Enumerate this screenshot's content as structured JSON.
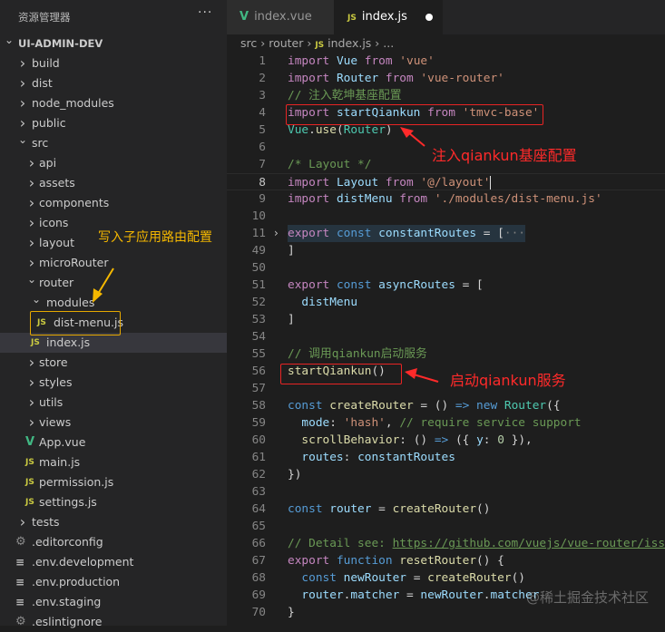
{
  "sidebar": {
    "title": "资源管理器",
    "more": "···",
    "items": [
      {
        "label": "UI-ADMIN-DEV",
        "type": "root",
        "icon": "chevron-down"
      },
      {
        "label": "build",
        "type": "folder",
        "level": 1
      },
      {
        "label": "dist",
        "type": "folder",
        "level": 1
      },
      {
        "label": "node_modules",
        "type": "folder",
        "level": 1
      },
      {
        "label": "public",
        "type": "folder",
        "level": 1
      },
      {
        "label": "src",
        "type": "folder-open",
        "level": 1
      },
      {
        "label": "api",
        "type": "folder",
        "level": 2
      },
      {
        "label": "assets",
        "type": "folder",
        "level": 2
      },
      {
        "label": "components",
        "type": "folder",
        "level": 2
      },
      {
        "label": "icons",
        "type": "folder",
        "level": 2
      },
      {
        "label": "layout",
        "type": "folder",
        "level": 2
      },
      {
        "label": "microRouter",
        "type": "folder",
        "level": 2
      },
      {
        "label": "router",
        "type": "folder-open",
        "level": 2
      },
      {
        "label": "modules",
        "type": "folder-open",
        "level": 3
      },
      {
        "label": "dist-menu.js",
        "type": "js",
        "level": 4
      },
      {
        "label": "index.js",
        "type": "js",
        "level": 3,
        "selected": true
      },
      {
        "label": "store",
        "type": "folder",
        "level": 2
      },
      {
        "label": "styles",
        "type": "folder",
        "level": 2
      },
      {
        "label": "utils",
        "type": "folder",
        "level": 2
      },
      {
        "label": "views",
        "type": "folder",
        "level": 2
      },
      {
        "label": "App.vue",
        "type": "vue",
        "level": 2
      },
      {
        "label": "main.js",
        "type": "js",
        "level": 2
      },
      {
        "label": "permission.js",
        "type": "js",
        "level": 2
      },
      {
        "label": "settings.js",
        "type": "js",
        "level": 2
      },
      {
        "label": "tests",
        "type": "folder",
        "level": 1
      },
      {
        "label": ".editorconfig",
        "type": "gear",
        "level": 1
      },
      {
        "label": ".env.development",
        "type": "lines",
        "level": 1
      },
      {
        "label": ".env.production",
        "type": "lines",
        "level": 1
      },
      {
        "label": ".env.staging",
        "type": "lines",
        "level": 1
      },
      {
        "label": ".eslintignore",
        "type": "gear",
        "level": 1
      }
    ]
  },
  "tabs": [
    {
      "label": "index.vue",
      "icon": "V"
    },
    {
      "label": "index.js",
      "icon": "JS",
      "modified": true
    }
  ],
  "breadcrumb": {
    "parts": [
      "src",
      "router"
    ],
    "file": "index.js",
    "icon": "JS",
    "tail": "..."
  },
  "code": [
    {
      "n": "1",
      "t": [
        [
          "import ",
          "kw"
        ],
        [
          "Vue ",
          "id"
        ],
        [
          "from ",
          "kw"
        ],
        [
          "'vue'",
          "str"
        ]
      ]
    },
    {
      "n": "2",
      "t": [
        [
          "import ",
          "kw"
        ],
        [
          "Router ",
          "id"
        ],
        [
          "from ",
          "kw"
        ],
        [
          "'vue-router'",
          "str"
        ]
      ]
    },
    {
      "n": "3",
      "t": [
        [
          "// 注入乾坤基座配置",
          "cm"
        ]
      ]
    },
    {
      "n": "4",
      "t": [
        [
          "import ",
          "kw"
        ],
        [
          "startQiankun ",
          "id"
        ],
        [
          "from ",
          "kw"
        ],
        [
          "'tmvc-base'",
          "str"
        ]
      ]
    },
    {
      "n": "5",
      "t": [
        [
          "Vue",
          "cls"
        ],
        [
          ".",
          ""
        ],
        [
          "use",
          "fn"
        ],
        [
          "(",
          ""
        ],
        [
          "Router",
          "cls"
        ],
        [
          ")",
          ""
        ]
      ]
    },
    {
      "n": "6",
      "t": []
    },
    {
      "n": "7",
      "t": [
        [
          "/* Layout */",
          "cm"
        ]
      ]
    },
    {
      "n": "8",
      "cur": true,
      "t": [
        [
          "import ",
          "kw"
        ],
        [
          "Layout ",
          "id"
        ],
        [
          "from ",
          "kw"
        ],
        [
          "'@/layout'",
          "str cursor"
        ]
      ]
    },
    {
      "n": "9",
      "t": [
        [
          "import ",
          "kw"
        ],
        [
          "distMenu ",
          "id"
        ],
        [
          "from ",
          "kw"
        ],
        [
          "'./modules/dist-menu.js'",
          "str"
        ]
      ]
    },
    {
      "n": "10",
      "t": []
    },
    {
      "n": "11",
      "fold": true,
      "t": [
        [
          "export ",
          "kw"
        ],
        [
          "const ",
          "st"
        ],
        [
          "constantRoutes",
          "id"
        ],
        [
          " = [",
          ""
        ],
        [
          "···",
          "el"
        ]
      ]
    },
    {
      "n": "49",
      "t": [
        [
          "]",
          ""
        ]
      ]
    },
    {
      "n": "50",
      "t": []
    },
    {
      "n": "51",
      "t": [
        [
          "export ",
          "kw"
        ],
        [
          "const ",
          "st"
        ],
        [
          "asyncRoutes",
          "id"
        ],
        [
          " = [",
          ""
        ]
      ]
    },
    {
      "n": "52",
      "t": [
        [
          "  distMenu",
          "id"
        ]
      ]
    },
    {
      "n": "53",
      "t": [
        [
          "]",
          ""
        ]
      ]
    },
    {
      "n": "54",
      "t": []
    },
    {
      "n": "55",
      "t": [
        [
          "// 调用qiankun启动服务",
          "cm"
        ]
      ]
    },
    {
      "n": "56",
      "t": [
        [
          "startQiankun",
          "fn"
        ],
        [
          "()",
          ""
        ]
      ]
    },
    {
      "n": "57",
      "t": []
    },
    {
      "n": "58",
      "t": [
        [
          "const ",
          "st"
        ],
        [
          "createRouter",
          "fn"
        ],
        [
          " = () ",
          ""
        ],
        [
          "=> ",
          "st"
        ],
        [
          "new ",
          "st"
        ],
        [
          "Router",
          "cls"
        ],
        [
          "({",
          ""
        ]
      ]
    },
    {
      "n": "59",
      "t": [
        [
          "  mode",
          "id"
        ],
        [
          ": ",
          ""
        ],
        [
          "'hash'",
          "str"
        ],
        [
          ", ",
          ""
        ],
        [
          "// require service support",
          "cm"
        ]
      ]
    },
    {
      "n": "60",
      "t": [
        [
          "  scrollBehavior",
          "fn"
        ],
        [
          ": () ",
          ""
        ],
        [
          "=> ",
          "st"
        ],
        [
          "({ ",
          ""
        ],
        [
          "y",
          "id"
        ],
        [
          ": ",
          ""
        ],
        [
          "0",
          "num"
        ],
        [
          " }),",
          ""
        ]
      ]
    },
    {
      "n": "61",
      "t": [
        [
          "  routes",
          "id"
        ],
        [
          ": ",
          ""
        ],
        [
          "constantRoutes",
          "id"
        ]
      ]
    },
    {
      "n": "62",
      "t": [
        [
          "})",
          ""
        ]
      ]
    },
    {
      "n": "63",
      "t": []
    },
    {
      "n": "64",
      "t": [
        [
          "const ",
          "st"
        ],
        [
          "router",
          "id"
        ],
        [
          " = ",
          ""
        ],
        [
          "createRouter",
          "fn"
        ],
        [
          "()",
          ""
        ]
      ]
    },
    {
      "n": "65",
      "t": []
    },
    {
      "n": "66",
      "t": [
        [
          "// Detail see: ",
          "cm"
        ],
        [
          "https://github.com/vuejs/vue-router/issues",
          "url"
        ]
      ]
    },
    {
      "n": "67",
      "t": [
        [
          "export ",
          "kw"
        ],
        [
          "function ",
          "st"
        ],
        [
          "resetRouter",
          "fn"
        ],
        [
          "() {",
          ""
        ]
      ]
    },
    {
      "n": "68",
      "t": [
        [
          "  const ",
          "st"
        ],
        [
          "newRouter",
          "id"
        ],
        [
          " = ",
          ""
        ],
        [
          "createRouter",
          "fn"
        ],
        [
          "()",
          ""
        ]
      ]
    },
    {
      "n": "69",
      "t": [
        [
          "  router",
          "id"
        ],
        [
          ".",
          ""
        ],
        [
          "matcher",
          "id"
        ],
        [
          " = ",
          ""
        ],
        [
          "newRouter",
          "id"
        ],
        [
          ".",
          ""
        ],
        [
          "matcher",
          "id"
        ]
      ]
    },
    {
      "n": "70",
      "t": [
        [
          "}",
          ""
        ]
      ]
    }
  ],
  "annotations": {
    "a1": "注入qiankun基座配置",
    "a2": "启动qiankun服务",
    "a3": "写入子应用路由配置"
  },
  "watermark": "@稀土掘金技术社区",
  "colors": {
    "annotation_red": "#ff2a2a",
    "annotation_yellow": "#f5b800",
    "selection": "#37373d"
  }
}
